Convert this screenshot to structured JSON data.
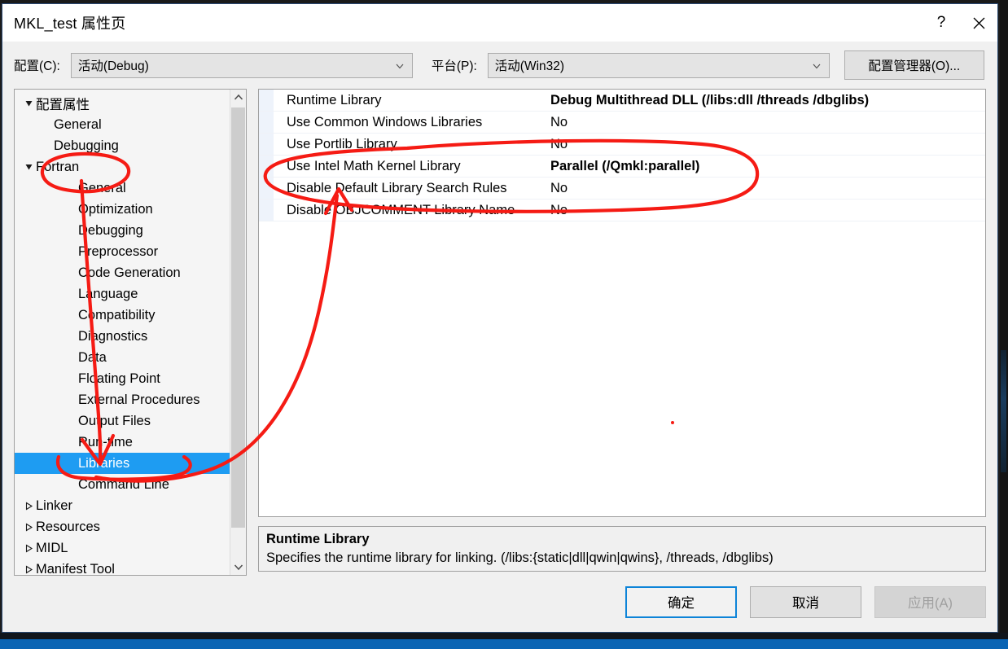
{
  "window": {
    "title": "MKL_test 属性页",
    "help_button": "?",
    "close_button": "✕",
    "help_icon": "question-mark-icon",
    "close_icon": "close-x-icon"
  },
  "configbar": {
    "config_label": "配置(C):",
    "config_value": "活动(Debug)",
    "platform_label": "平台(P):",
    "platform_value": "活动(Win32)",
    "config_manager_button": "配置管理器(O)...",
    "dropdown_icon": "chevron-down-icon"
  },
  "tree": {
    "scroll_up_icon": "chevron-up-icon",
    "scroll_down_icon": "chevron-down-icon",
    "items": [
      {
        "label": "配置属性",
        "indent": 0,
        "expander": "expanded",
        "selected": false
      },
      {
        "label": "General",
        "indent": 1,
        "expander": "none",
        "selected": false
      },
      {
        "label": "Debugging",
        "indent": 1,
        "expander": "none",
        "selected": false
      },
      {
        "label": "Fortran",
        "indent": 0,
        "expander": "expanded",
        "selected": false
      },
      {
        "label": "General",
        "indent": 2,
        "expander": "none",
        "selected": false
      },
      {
        "label": "Optimization",
        "indent": 2,
        "expander": "none",
        "selected": false
      },
      {
        "label": "Debugging",
        "indent": 2,
        "expander": "none",
        "selected": false
      },
      {
        "label": "Preprocessor",
        "indent": 2,
        "expander": "none",
        "selected": false
      },
      {
        "label": "Code Generation",
        "indent": 2,
        "expander": "none",
        "selected": false
      },
      {
        "label": "Language",
        "indent": 2,
        "expander": "none",
        "selected": false
      },
      {
        "label": "Compatibility",
        "indent": 2,
        "expander": "none",
        "selected": false
      },
      {
        "label": "Diagnostics",
        "indent": 2,
        "expander": "none",
        "selected": false
      },
      {
        "label": "Data",
        "indent": 2,
        "expander": "none",
        "selected": false
      },
      {
        "label": "Floating Point",
        "indent": 2,
        "expander": "none",
        "selected": false
      },
      {
        "label": "External Procedures",
        "indent": 2,
        "expander": "none",
        "selected": false
      },
      {
        "label": "Output Files",
        "indent": 2,
        "expander": "none",
        "selected": false
      },
      {
        "label": "Run-time",
        "indent": 2,
        "expander": "none",
        "selected": false
      },
      {
        "label": "Libraries",
        "indent": 2,
        "expander": "none",
        "selected": true
      },
      {
        "label": "Command Line",
        "indent": 2,
        "expander": "none",
        "selected": false
      },
      {
        "label": "Linker",
        "indent": 0,
        "expander": "collapsed",
        "selected": false
      },
      {
        "label": "Resources",
        "indent": 0,
        "expander": "collapsed",
        "selected": false
      },
      {
        "label": "MIDL",
        "indent": 0,
        "expander": "collapsed",
        "selected": false
      },
      {
        "label": "Manifest Tool",
        "indent": 0,
        "expander": "collapsed",
        "selected": false
      }
    ]
  },
  "propgrid": {
    "rows": [
      {
        "name": "Runtime Library",
        "value": "Debug Multithread DLL (/libs:dll /threads /dbglibs)",
        "bold": true
      },
      {
        "name": "Use Common Windows Libraries",
        "value": "No",
        "bold": false
      },
      {
        "name": "Use Portlib Library",
        "value": "No",
        "bold": false
      },
      {
        "name": "Use Intel Math Kernel Library",
        "value": "Parallel (/Qmkl:parallel)",
        "bold": true
      },
      {
        "name": "Disable Default Library Search Rules",
        "value": "No",
        "bold": false
      },
      {
        "name": "Disable OBJCOMMENT Library Name",
        "value": "No",
        "bold": false
      }
    ]
  },
  "description": {
    "title": "Runtime Library",
    "text": "Specifies the runtime library for linking. (/libs:{static|dll|qwin|qwins}, /threads, /dbglibs)"
  },
  "footer": {
    "ok": "确定",
    "cancel": "取消",
    "apply": "应用(A)"
  },
  "annotation": {
    "color": "#f51b14",
    "description": "hand-drawn red marker: ellipse around Fortran tree node, ellipse around Use Portlib/Use Intel Math Kernel/Disable Default Library rows, arrow from Fortran down to Libraries, curve from Libraries to the property rows, arrow pointing up into Disable Default Library Search Rules"
  }
}
